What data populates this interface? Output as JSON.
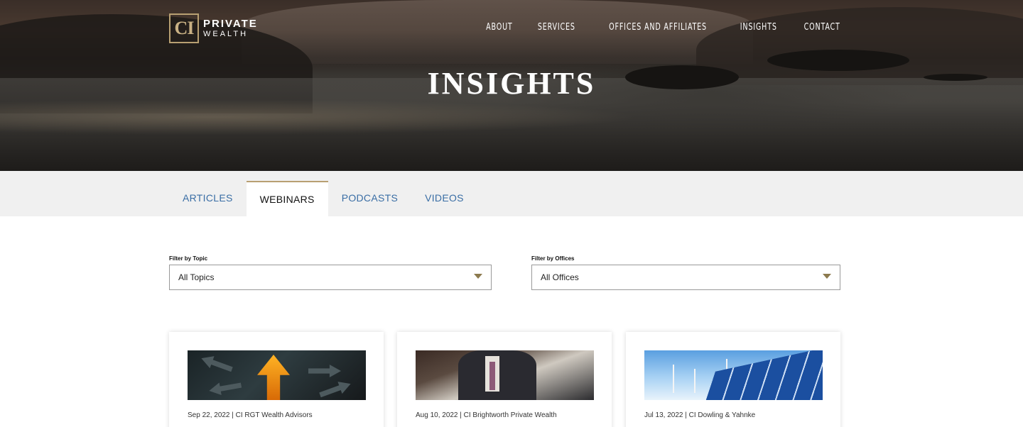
{
  "header": {
    "logo": {
      "mark": "CI",
      "line1": "PRIVATE",
      "line2": "WEALTH"
    },
    "nav": [
      "ABOUT",
      "SERVICES",
      "OFFICES AND AFFILIATES",
      "INSIGHTS",
      "CONTACT"
    ]
  },
  "hero": {
    "title": "INSIGHTS"
  },
  "tabs": [
    {
      "label": "ARTICLES",
      "active": false
    },
    {
      "label": "WEBINARS",
      "active": true
    },
    {
      "label": "PODCASTS",
      "active": false
    },
    {
      "label": "VIDEOS",
      "active": false
    }
  ],
  "filters": {
    "topic": {
      "label": "Filter by Topic",
      "value": "All Topics"
    },
    "offices": {
      "label": "Filter by Offices",
      "value": "All Offices"
    }
  },
  "cards": [
    {
      "date": "Sep 22, 2022",
      "office": "CI RGT Wealth Advisors",
      "meta": "Sep 22, 2022 | CI RGT Wealth Advisors",
      "image": "orange-arrow-up-image"
    },
    {
      "date": "Aug 10, 2022",
      "office": "CI Brightworth Private Wealth",
      "meta": "Aug 10, 2022 | CI Brightworth Private Wealth",
      "image": "businessman-tablet-image"
    },
    {
      "date": "Jul 13, 2022",
      "office": "CI Dowling & Yahnke",
      "meta": "Jul 13, 2022 | CI Dowling & Yahnke",
      "image": "solar-panels-wind-turbines-image"
    }
  ],
  "colors": {
    "accent": "#b8a072",
    "tab_link": "#3a6ea5",
    "tabs_bg": "#f0f0f0"
  }
}
